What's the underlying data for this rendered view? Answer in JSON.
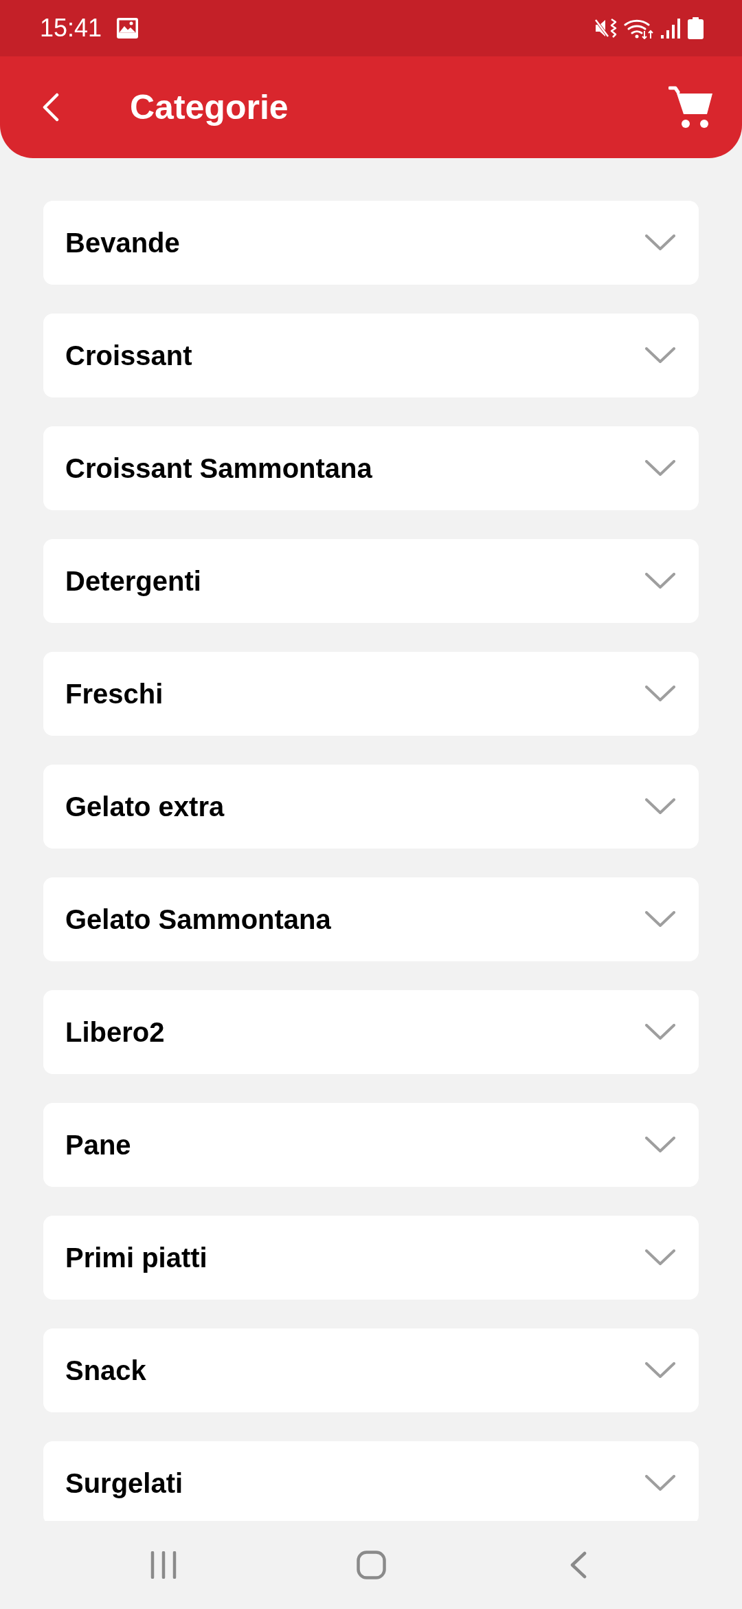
{
  "status_bar": {
    "time": "15:41"
  },
  "header": {
    "title": "Categorie"
  },
  "categories": [
    {
      "label": "Bevande",
      "expanded": false
    },
    {
      "label": "Croissant",
      "expanded": false
    },
    {
      "label": "Croissant Sammontana",
      "expanded": false
    },
    {
      "label": "Detergenti",
      "expanded": false
    },
    {
      "label": "Freschi",
      "expanded": false
    },
    {
      "label": "Gelato extra",
      "expanded": false
    },
    {
      "label": "Gelato Sammontana",
      "expanded": false
    },
    {
      "label": "Libero2",
      "expanded": false
    },
    {
      "label": "Pane",
      "expanded": false
    },
    {
      "label": "Primi piatti",
      "expanded": false
    },
    {
      "label": "Snack",
      "expanded": false
    },
    {
      "label": "Surgelati",
      "expanded": false
    }
  ]
}
